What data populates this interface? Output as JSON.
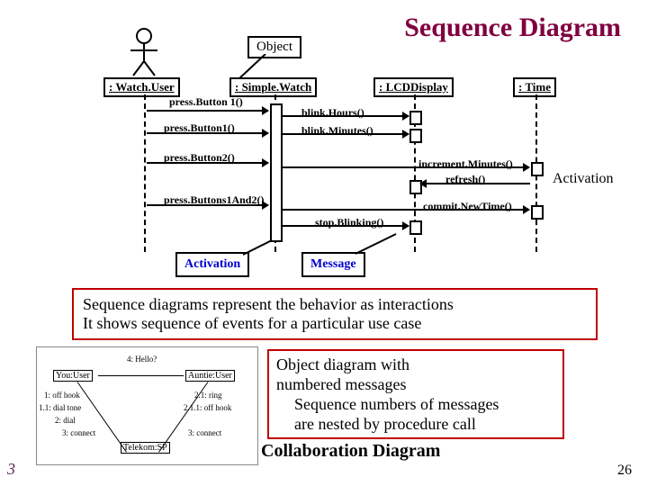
{
  "title": "Sequence Diagram",
  "labels": {
    "object": "Object",
    "activation": "Activation",
    "message": "Message",
    "activation_right": "Activation"
  },
  "lifelines": {
    "watchuser": ": Watch.User",
    "simplewatch": ": Simple.Watch",
    "lcddisplay": ": LCDDisplay",
    "time": ": Time"
  },
  "messages": {
    "m1": "press.Button 1()",
    "m2": "press.Button1()",
    "m3": "blink.Hours()",
    "m4": "blink.Minutes()",
    "m5": "press.Button2()",
    "m6": "increment.Minutes()",
    "m7": "refresh()",
    "m8": "press.Buttons1And2()",
    "m9": "commit.NewTime()",
    "m10": "stop.Blinking()"
  },
  "caption1_line1": "Sequence diagrams represent the behavior as interactions",
  "caption1_line2": "It shows sequence of events for a particular use case",
  "right_block": {
    "l1": "Object diagram with",
    "l2": "numbered messages",
    "l3": "Sequence numbers of  messages",
    "l4": "are nested by procedure call"
  },
  "collab_title": "Collaboration Diagram",
  "collab": {
    "n1": "You:User",
    "n2": "Auntie:User",
    "n3": "Telekom:SP",
    "e1": "4: Hello?",
    "e2": "1: off hook",
    "e3": "1.1: dial tone",
    "e4": "2: dial",
    "e5": "2.1: ring",
    "e6": "2.1.1: off hook",
    "e7": "3: connect",
    "e8": "3: connect"
  },
  "page_right": "26",
  "page_left": "3"
}
